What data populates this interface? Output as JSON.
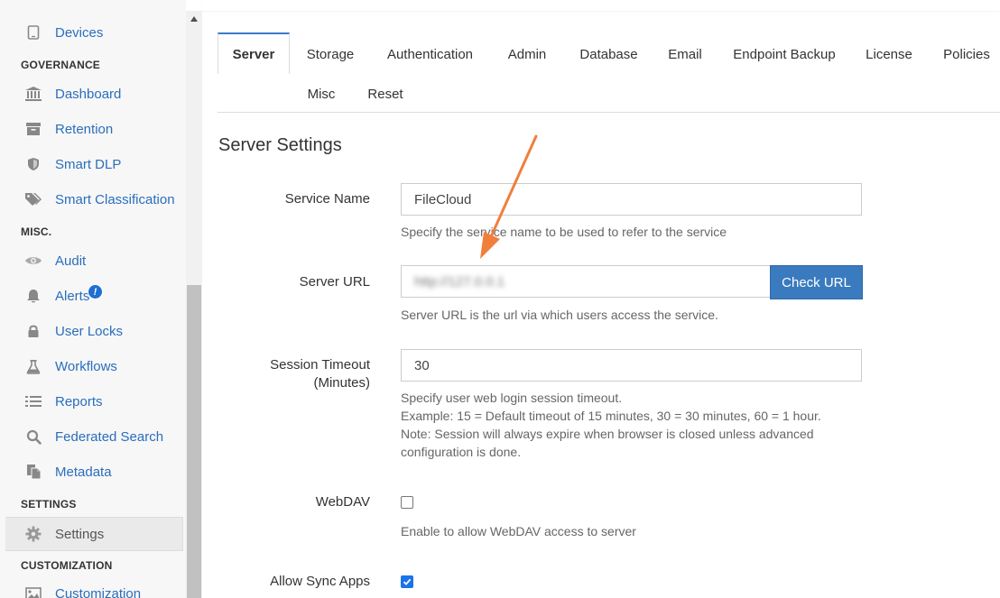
{
  "sidebar": {
    "items_top": [
      {
        "label": "Devices",
        "icon": "device-icon"
      }
    ],
    "sections": {
      "governance": "GOVERNANCE",
      "misc": "MISC.",
      "settings": "SETTINGS",
      "customization": "CUSTOMIZATION"
    },
    "governance_items": [
      {
        "label": "Dashboard",
        "icon": "bank-icon"
      },
      {
        "label": "Retention",
        "icon": "archive-icon"
      },
      {
        "label": "Smart DLP",
        "icon": "shield-icon"
      },
      {
        "label": "Smart Classification",
        "icon": "tags-icon"
      }
    ],
    "misc_items": [
      {
        "label": "Audit",
        "icon": "eye-icon"
      },
      {
        "label": "Alerts",
        "icon": "bell-icon",
        "badge": "!"
      },
      {
        "label": "User Locks",
        "icon": "lock-icon"
      },
      {
        "label": "Workflows",
        "icon": "flask-icon"
      },
      {
        "label": "Reports",
        "icon": "list-icon"
      },
      {
        "label": "Federated Search",
        "icon": "search-icon"
      },
      {
        "label": "Metadata",
        "icon": "files-icon"
      }
    ],
    "settings_items": [
      {
        "label": "Settings",
        "icon": "gear-icon",
        "active": true
      }
    ],
    "customization_items": [
      {
        "label": "Customization",
        "icon": "image-icon"
      }
    ]
  },
  "tabs": [
    "Server",
    "Storage",
    "Authentication",
    "Admin",
    "Database",
    "Email",
    "Endpoint Backup",
    "License",
    "Policies",
    "Misc",
    "Reset"
  ],
  "active_tab": "Server",
  "section_title": "Server Settings",
  "fields": {
    "service_name": {
      "label": "Service Name",
      "value": "FileCloud",
      "help": "Specify the service name to be used to refer to the service"
    },
    "server_url": {
      "label": "Server URL",
      "value": "http://127.0.0.1",
      "button": "Check URL",
      "help": "Server URL is the url via which users access the service."
    },
    "session_timeout": {
      "label_line1": "Session Timeout",
      "label_line2": "(Minutes)",
      "value": "30",
      "help_lines": [
        "Specify user web login session timeout.",
        "Example: 15 = Default timeout of 15 minutes, 30 = 30 minutes, 60 = 1 hour.",
        "Note: Session will always expire when browser is closed unless advanced",
        "configuration is done."
      ]
    },
    "webdav": {
      "label": "WebDAV",
      "checked": false,
      "help": "Enable to allow WebDAV access to server"
    },
    "allow_sync_apps": {
      "label": "Allow Sync Apps",
      "checked": true
    }
  },
  "colors": {
    "link": "#2a6ebd",
    "accent": "#3a7bbf",
    "annotation_arrow": "#f07f3c"
  }
}
